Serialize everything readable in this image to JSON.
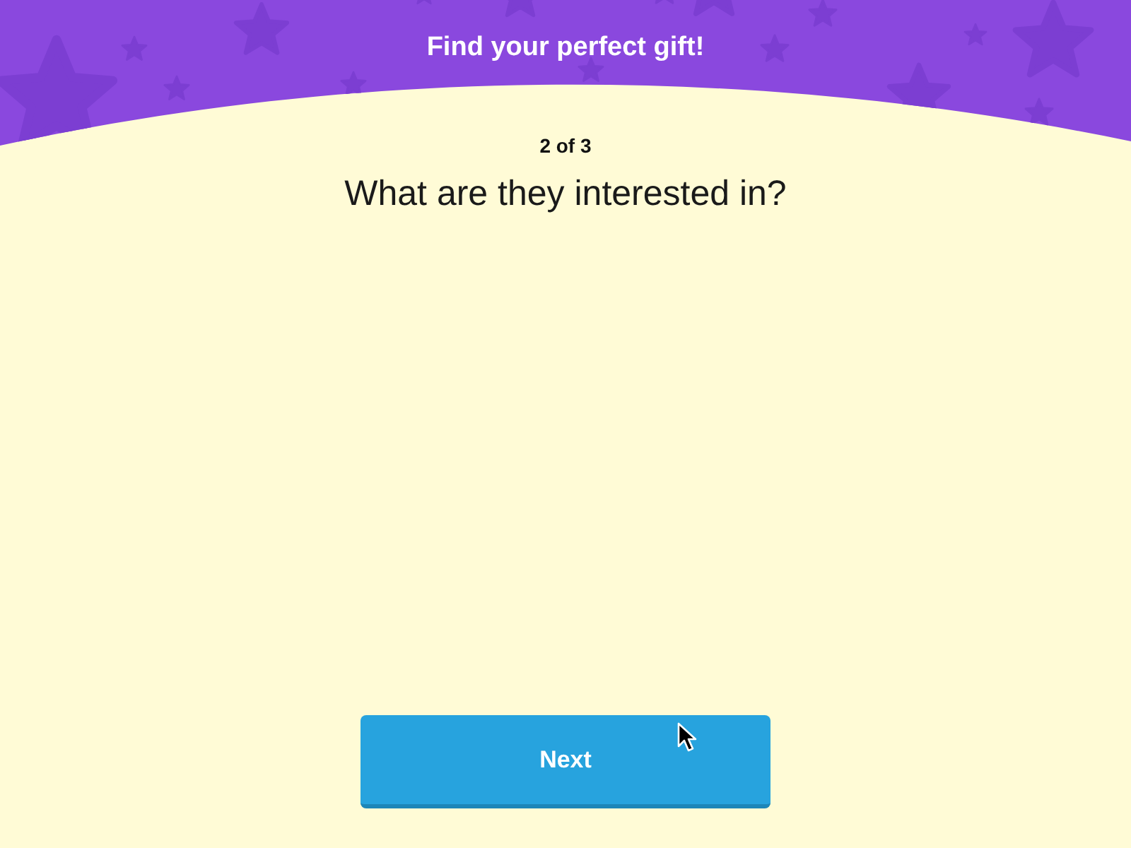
{
  "header": {
    "title": "Find your perfect gift!"
  },
  "step": {
    "progress": "2 of 3",
    "question": "What are they interested in?"
  },
  "next_button": {
    "label": "Next"
  }
}
